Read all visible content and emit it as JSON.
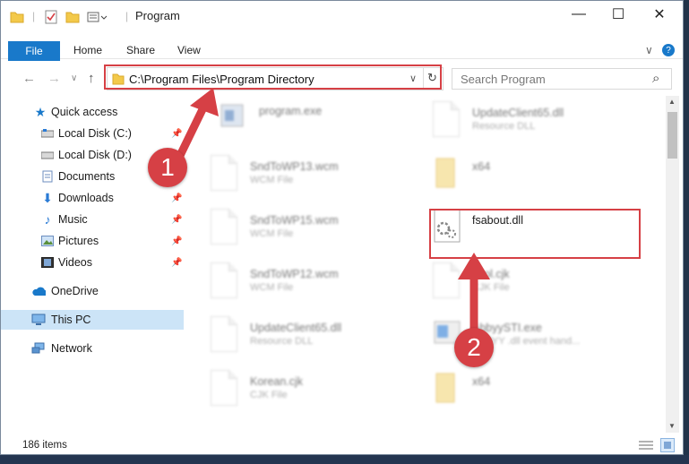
{
  "window": {
    "title": "Program",
    "minimize": "—",
    "maximize": "☐",
    "close": "✕"
  },
  "ribbon": {
    "file_tab": "File",
    "tabs": [
      "Home",
      "Share",
      "View"
    ],
    "expand": "∨",
    "help": "?"
  },
  "nav": {
    "back": "←",
    "forward": "→",
    "recent": "∨",
    "up": "↑",
    "address": "C:\\Program Files\\Program Directory",
    "address_dropdown": "∨",
    "refresh": "↻",
    "search_placeholder": "Search Program",
    "search_icon": "⌕"
  },
  "sidebar": {
    "items": [
      {
        "label": "Quick access",
        "icon": "star-icon"
      },
      {
        "label": "Local Disk (C:)",
        "icon": "drive-icon",
        "pinned": true
      },
      {
        "label": "Local Disk (D:)",
        "icon": "drive-icon"
      },
      {
        "label": "Documents",
        "icon": "documents-icon",
        "pinned": true
      },
      {
        "label": "Downloads",
        "icon": "downloads-icon",
        "pinned": true
      },
      {
        "label": "Music",
        "icon": "music-icon",
        "pinned": true
      },
      {
        "label": "Pictures",
        "icon": "pictures-icon",
        "pinned": true
      },
      {
        "label": "Videos",
        "icon": "videos-icon",
        "pinned": true
      },
      {
        "label": "OneDrive",
        "icon": "cloud-icon"
      },
      {
        "label": "This PC",
        "icon": "computer-icon",
        "selected": true
      },
      {
        "label": "Network",
        "icon": "network-icon"
      }
    ]
  },
  "files": [
    {
      "name": "program.exe",
      "type": "",
      "icon": "exe-icon"
    },
    {
      "name": "UpdateClient65.dll",
      "type": "Resource DLL",
      "icon": "dll-icon"
    },
    {
      "name": "SndToWP13.wcm",
      "type": "WCM File",
      "icon": "file-icon"
    },
    {
      "name": "x64",
      "type": "",
      "icon": "folder-icon"
    },
    {
      "name": "SndToWP15.wcm",
      "type": "WCM File",
      "icon": "file-icon"
    },
    {
      "name": "fsabout.dll",
      "type": "",
      "icon": "dll-icon"
    },
    {
      "name": "SndToWP12.wcm",
      "type": "WCM File",
      "icon": "file-icon"
    },
    {
      "name": "Tool.cjk",
      "type": "CJK File",
      "icon": "file-icon"
    },
    {
      "name": "UpdateClient65.dll",
      "type": "Resource DLL",
      "icon": "dll-icon"
    },
    {
      "name": "AbbyySTI.exe",
      "type": "ABBYY .dll event hand...",
      "icon": "exe-icon"
    },
    {
      "name": "Korean.cjk",
      "type": "CJK File",
      "icon": "file-icon"
    },
    {
      "name": "x64",
      "type": "",
      "icon": "folder-icon"
    }
  ],
  "status": {
    "item_count": "186 items"
  },
  "callouts": [
    {
      "number": "1"
    },
    {
      "number": "2"
    }
  ],
  "colors": {
    "accent": "#1979ca",
    "highlight": "#d64045",
    "selected": "#cce4f7"
  }
}
